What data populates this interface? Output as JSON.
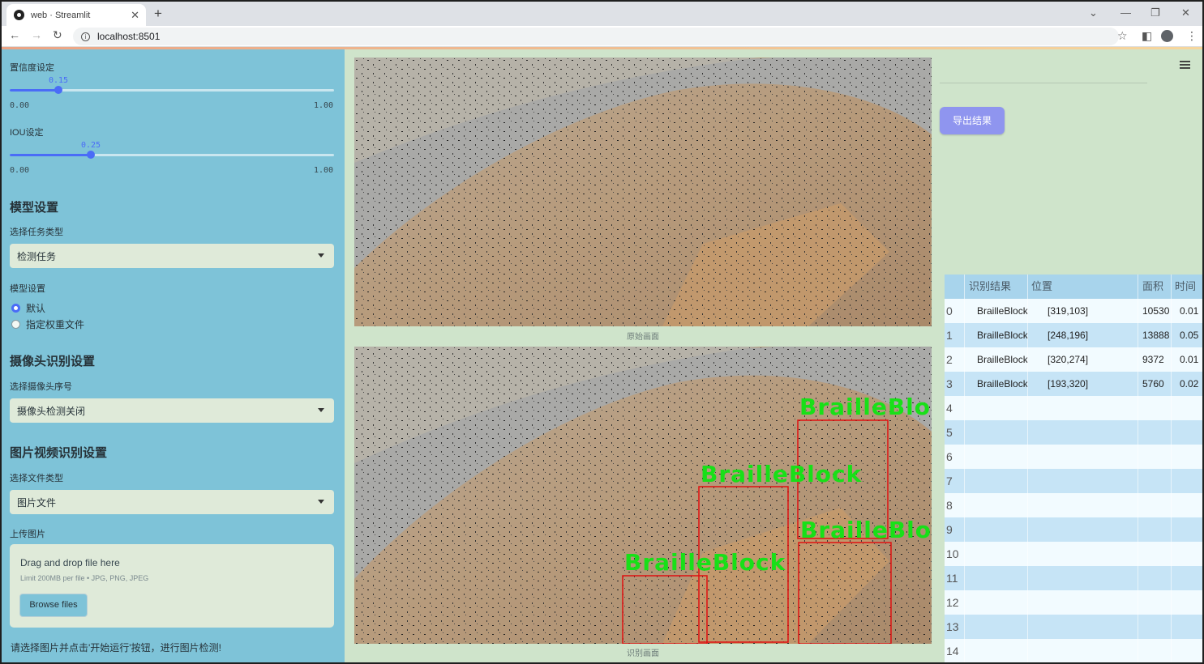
{
  "browser": {
    "tab_title": "web · Streamlit",
    "url": "localhost:8501"
  },
  "sidebar": {
    "confidence": {
      "label": "置信度设定",
      "value": "0.15",
      "value_fraction": 0.15,
      "min": "0.00",
      "max": "1.00"
    },
    "iou": {
      "label": "IOU设定",
      "value": "0.25",
      "value_fraction": 0.25,
      "min": "0.00",
      "max": "1.00"
    },
    "model_section": "模型设置",
    "task_label": "选择任务类型",
    "task_value": "检测任务",
    "model_label": "模型设置",
    "model_options": [
      {
        "label": "默认",
        "selected": true
      },
      {
        "label": "指定权重文件",
        "selected": false
      }
    ],
    "camera_section": "摄像头识别设置",
    "camera_label": "选择摄像头序号",
    "camera_value": "摄像头检测关闭",
    "media_section": "图片视频识别设置",
    "filetype_label": "选择文件类型",
    "filetype_value": "图片文件",
    "upload_label": "上传图片",
    "upload_main": "Drag and drop file here",
    "upload_sub": "Limit 200MB per file • JPG, PNG, JPEG",
    "browse_label": "Browse files",
    "hint": "请选择图片并点击'开始运行'按钮，进行图片检测!"
  },
  "main": {
    "original_caption": "原始画面",
    "result_caption": "识别画面",
    "detection_label": "BrailleBlock",
    "box_color": "#e01010",
    "label_color": "#18e018"
  },
  "right": {
    "export_label": "导出结果",
    "table": {
      "headers": [
        "识别结果",
        "位置",
        "面积",
        "时间"
      ],
      "rows": [
        {
          "index": "0",
          "result": "BrailleBlock",
          "position": "[319,103]",
          "area": "10530",
          "time": "0.01"
        },
        {
          "index": "1",
          "result": "BrailleBlock",
          "position": "[248,196]",
          "area": "13888",
          "time": "0.05"
        },
        {
          "index": "2",
          "result": "BrailleBlock",
          "position": "[320,274]",
          "area": "9372",
          "time": "0.01"
        },
        {
          "index": "3",
          "result": "BrailleBlock",
          "position": "[193,320]",
          "area": "5760",
          "time": "0.02"
        },
        {
          "index": "4"
        },
        {
          "index": "5"
        },
        {
          "index": "6"
        },
        {
          "index": "7"
        },
        {
          "index": "8"
        },
        {
          "index": "9"
        },
        {
          "index": "10"
        },
        {
          "index": "11"
        },
        {
          "index": "12"
        },
        {
          "index": "13"
        },
        {
          "index": "14"
        }
      ]
    }
  }
}
